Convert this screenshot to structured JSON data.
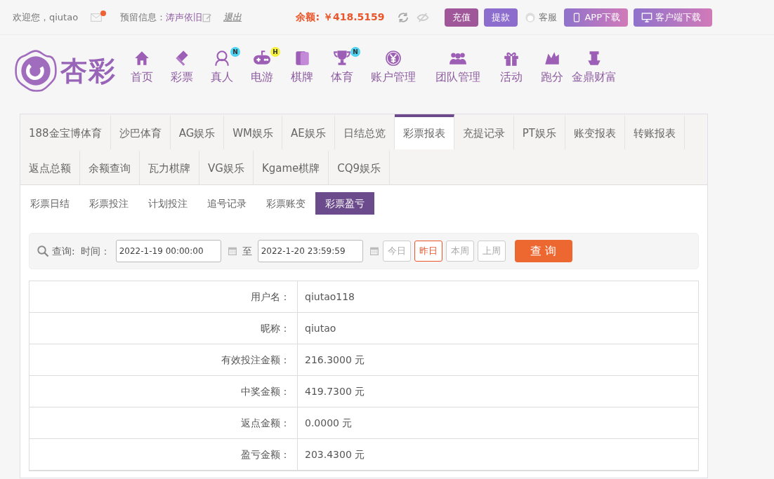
{
  "top_bar": {
    "welcome": "欢迎您，qiutao",
    "has_unread_mail": true,
    "message_label": "预留信息：",
    "message_value": "涛声依旧",
    "logout": "退出",
    "balance_label": "余额:",
    "balance_value": "￥418.5159",
    "buttons": [
      {
        "label": "充值",
        "kind": "deposit"
      },
      {
        "label": "提款",
        "kind": "withdraw"
      },
      {
        "label": "客服",
        "kind": "service"
      },
      {
        "label": "APP下载",
        "kind": "app"
      },
      {
        "label": "客户端下载",
        "kind": "client"
      }
    ]
  },
  "logo": {
    "text": "杏彩"
  },
  "nav": [
    {
      "label": "首页"
    },
    {
      "label": "彩票"
    },
    {
      "label": "真人",
      "badge": "N",
      "color": "#4fd3f0"
    },
    {
      "label": "电游",
      "badge": "H",
      "color": "#f5f03c"
    },
    {
      "label": "棋牌"
    },
    {
      "label": "体育",
      "badge": "N",
      "color": "#4fd3f0"
    },
    {
      "label": "账户管理"
    },
    {
      "label": "团队管理"
    },
    {
      "label": "活动"
    },
    {
      "label": "跑分"
    },
    {
      "label": "金鼎财富"
    }
  ],
  "tabs": [
    [
      {
        "label": "188金宝博体育",
        "selected": false
      },
      {
        "label": "沙巴体育",
        "selected": false
      },
      {
        "label": "AG娱乐",
        "selected": false
      },
      {
        "label": "WM娱乐",
        "selected": false
      },
      {
        "label": "AE娱乐",
        "selected": false
      },
      {
        "label": "日结总览",
        "selected": false
      },
      {
        "label": "彩票报表",
        "selected": true
      },
      {
        "label": "充提记录",
        "selected": false
      },
      {
        "label": "PT娱乐",
        "selected": false
      },
      {
        "label": "账变报表",
        "selected": false
      },
      {
        "label": "转账报表",
        "selected": false
      }
    ],
    [
      {
        "label": "返点总额",
        "selected": false
      },
      {
        "label": "余额查询",
        "selected": false
      },
      {
        "label": "瓦力棋牌",
        "selected": false
      },
      {
        "label": "VG娱乐",
        "selected": false
      },
      {
        "label": "Kgame棋牌",
        "selected": false
      },
      {
        "label": "CQ9娱乐",
        "selected": false
      }
    ]
  ],
  "sub_tabs": [
    {
      "label": "彩票日结",
      "selected": false
    },
    {
      "label": "彩票投注",
      "selected": false
    },
    {
      "label": "计划投注",
      "selected": false
    },
    {
      "label": "追号记录",
      "selected": false
    },
    {
      "label": "彩票账变",
      "selected": false
    },
    {
      "label": "彩票盈亏",
      "selected": true
    }
  ],
  "search": {
    "label": "查询:",
    "time_label": "时间：",
    "start": "2022-1-19 00:00:00",
    "separator": "至",
    "end": "2022-1-20 23:59:59",
    "quick": [
      {
        "label": "今日",
        "selected": false
      },
      {
        "label": "昨日",
        "selected": true
      },
      {
        "label": "本周",
        "selected": false
      },
      {
        "label": "上周",
        "selected": false
      }
    ],
    "submit": "查 询"
  },
  "table": {
    "rows": [
      {
        "label": "用户名：",
        "value": "qiutao118"
      },
      {
        "label": "昵称：",
        "value": "qiutao"
      },
      {
        "label": "有效投注金额：",
        "value": "216.3000 元"
      },
      {
        "label": "中奖金额：",
        "value": "419.7300 元"
      },
      {
        "label": "返点金额：",
        "value": "0.0000 元"
      },
      {
        "label": "盈亏金额：",
        "value": "203.4300 元"
      }
    ]
  }
}
